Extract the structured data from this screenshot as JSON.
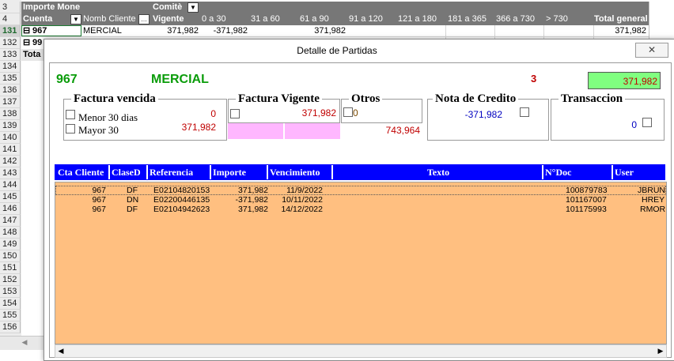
{
  "spreadsheet": {
    "row_numbers": [
      "3",
      "4",
      "131",
      "132",
      "133",
      "134",
      "135",
      "136",
      "137",
      "138",
      "139",
      "140",
      "141",
      "142",
      "143",
      "144",
      "145",
      "146",
      "147",
      "148",
      "149",
      "150",
      "151",
      "152",
      "153",
      "154",
      "155",
      "156"
    ],
    "selected_row": "131",
    "pivot": {
      "values_label": "Importe Mone",
      "column_field": "Comitè",
      "row_field_1": "Cuenta",
      "row_field_2": "Nomb Cliente",
      "columns": [
        "Vigente",
        "0 a 30",
        "31 a 60",
        "61 a 90",
        "91 a 120",
        "121 a 180",
        "181 a 365",
        "366 a 730",
        "> 730",
        "Total general"
      ],
      "row_131": {
        "cuenta": "967",
        "cliente": "MERCIAL",
        "vigente": "371,982",
        "d0_30": "-371,982",
        "d61_90": "371,982",
        "total": "371,982"
      },
      "row_132_cuenta": "99",
      "row_133_label": "Tota"
    }
  },
  "dialog": {
    "title": "Detalle de Partidas",
    "close_label": "✕",
    "account": "967",
    "client": "MERCIAL",
    "count": "3",
    "total": "371,982",
    "factura_vencida": {
      "title": "Factura vencida",
      "menor_label": "Menor 30 dias",
      "menor_value": "0",
      "mayor_label": "Mayor 30",
      "mayor_value": "371,982"
    },
    "factura_vigente": {
      "title": "Factura Vigente",
      "value": "371,982"
    },
    "otros": {
      "title": "Otros",
      "value": "0",
      "sum": "743,964"
    },
    "nota_credito": {
      "title": "Nota de Credito",
      "value": "-371,982"
    },
    "transaccion": {
      "title": "Transaccion",
      "value": "0"
    },
    "table": {
      "headers": [
        "Cta Cliente",
        "ClaseD",
        "Referencia",
        "Importe",
        "Vencimiento",
        "Texto",
        "N°Doc",
        "User"
      ],
      "rows": [
        {
          "cta": "967",
          "clase": "DF",
          "ref": "E02104820153",
          "importe": "371,982",
          "venc": "11/9/2022",
          "texto": "",
          "doc": "100879783",
          "user": "JBRUN"
        },
        {
          "cta": "967",
          "clase": "DN",
          "ref": "E02200446135",
          "importe": "-371,982",
          "venc": "10/11/2022",
          "texto": "",
          "doc": "101167007",
          "user": "HREY"
        },
        {
          "cta": "967",
          "clase": "DF",
          "ref": "E02104942623",
          "importe": "371,982",
          "venc": "14/12/2022",
          "texto": "",
          "doc": "101175993",
          "user": "RMOR"
        }
      ]
    },
    "colors": {
      "header_blue": "#0000ff",
      "table_bg": "#ffbf80",
      "total_bg": "#80ff80",
      "pink": "#ffb7ff",
      "green_text": "#0a9c0a",
      "red_text": "#c00000"
    }
  }
}
